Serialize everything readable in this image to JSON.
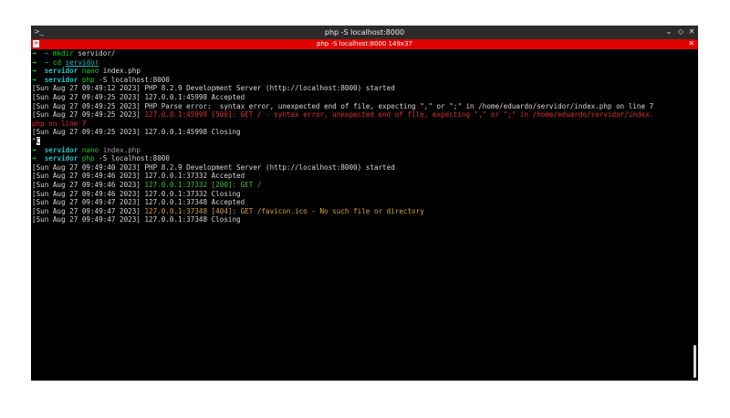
{
  "window": {
    "title": "php -S localhost:8000",
    "app_icon": "terminal-icon",
    "controls": {
      "minimize": "⌄",
      "maximize": "◇",
      "close": "✕"
    }
  },
  "tab": {
    "title": "php -S localhost:8000 149x37",
    "icon": "terminal-tab-icon",
    "close": "✕"
  },
  "terminal": {
    "prompt_arrow": "➜",
    "tilde": "~",
    "dir": "servidor",
    "lines": [
      {
        "type": "prompt",
        "path": "~",
        "cmd": "mkdir",
        "args": "servidor/"
      },
      {
        "type": "prompt",
        "path": "~",
        "cmd": "cd",
        "args": "servidor"
      },
      {
        "type": "prompt",
        "path": "servidor",
        "cmd": "nano",
        "args": "index.php"
      },
      {
        "type": "prompt",
        "path": "servidor",
        "cmd": "php",
        "args": "-S localhost:8000"
      },
      {
        "type": "log",
        "ts": "[Sun Aug 27 09:49:12 2023]",
        "msg": "PHP 8.2.9 Development Server (http://localhost:8000) started"
      },
      {
        "type": "log",
        "ts": "[Sun Aug 27 09:49:25 2023]",
        "msg": "127.0.0.1:45998 Accepted"
      },
      {
        "type": "log",
        "ts": "[Sun Aug 27 09:49:25 2023]",
        "msg": "PHP Parse error:  syntax error, unexpected end of file, expecting \",\" or \";\" in /home/eduardo/servidor/index.php on line 7"
      },
      {
        "type": "log-red",
        "ts": "[Sun Aug 27 09:49:25 2023]",
        "msg": "127.0.0.1:45998 [500]: GET / - syntax error, unexpected end of file, expecting \",\" or \";\" in /home/eduardo/servidor/index.",
        "cont": "php on line 7"
      },
      {
        "type": "log",
        "ts": "[Sun Aug 27 09:49:25 2023]",
        "msg": "127.0.0.1:45998 Closing"
      },
      {
        "type": "interrupt",
        "text": "^C"
      },
      {
        "type": "prompt",
        "path": "servidor",
        "cmd": "nano",
        "args": "index.php"
      },
      {
        "type": "prompt",
        "path": "servidor",
        "cmd": "php",
        "args": "-S localhost:8000"
      },
      {
        "type": "log",
        "ts": "[Sun Aug 27 09:49:40 2023]",
        "msg": "PHP 8.2.9 Development Server (http://localhost:8000) started"
      },
      {
        "type": "log",
        "ts": "[Sun Aug 27 09:49:46 2023]",
        "msg": "127.0.0.1:37332 Accepted"
      },
      {
        "type": "log-green",
        "ts": "[Sun Aug 27 09:49:46 2023]",
        "msg": "127.0.0.1:37332 [200]: GET /"
      },
      {
        "type": "log",
        "ts": "[Sun Aug 27 09:49:46 2023]",
        "msg": "127.0.0.1:37332 Closing"
      },
      {
        "type": "log",
        "ts": "[Sun Aug 27 09:49:47 2023]",
        "msg": "127.0.0.1:37348 Accepted"
      },
      {
        "type": "log-yellow",
        "ts": "[Sun Aug 27 09:49:47 2023]",
        "msg": "127.0.0.1:37348 [404]: GET /favicon.ico - No such file or directory"
      },
      {
        "type": "log",
        "ts": "[Sun Aug 27 09:49:47 2023]",
        "msg": "127.0.0.1:37348 Closing"
      }
    ]
  }
}
